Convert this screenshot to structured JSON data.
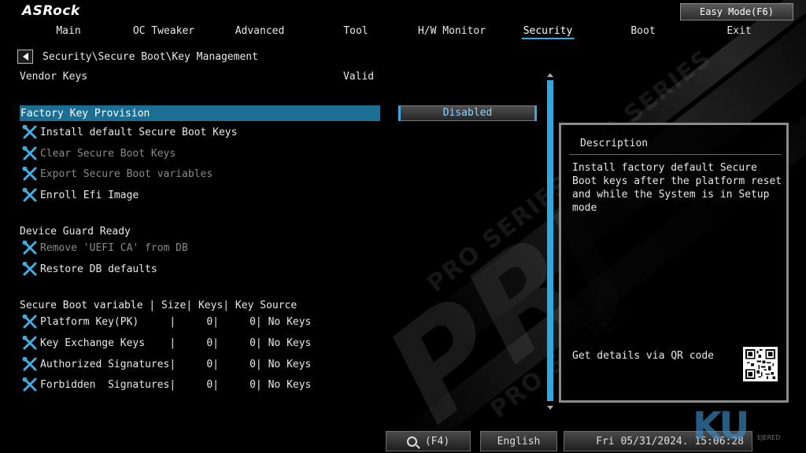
{
  "brand": {
    "logo": "ASRock"
  },
  "header": {
    "easy_mode_label": "Easy Mode(F6)"
  },
  "nav": {
    "tabs": [
      {
        "label": "Main"
      },
      {
        "label": "OC Tweaker"
      },
      {
        "label": "Advanced"
      },
      {
        "label": "Tool"
      },
      {
        "label": "H/W Monitor"
      },
      {
        "label": "Security",
        "active": true
      },
      {
        "label": "Boot"
      },
      {
        "label": "Exit"
      }
    ]
  },
  "breadcrumb": "Security\\Secure Boot\\Key Management",
  "settings": {
    "vendor_keys_label": "Vendor Keys",
    "vendor_keys_value": "Valid",
    "factory_key_label": "Factory Key Provision",
    "factory_key_value": "Disabled",
    "actions": [
      {
        "label": "Install default Secure Boot Keys",
        "enabled": true
      },
      {
        "label": "Clear Secure Boot Keys",
        "enabled": false
      },
      {
        "label": "Export Secure Boot variables",
        "enabled": false
      },
      {
        "label": "Enroll Efi Image",
        "enabled": true
      }
    ],
    "device_guard_label": "Device Guard Ready",
    "device_guard_actions": [
      {
        "label": "Remove 'UEFI CA' from DB",
        "enabled": false
      },
      {
        "label": "Restore DB defaults",
        "enabled": true
      }
    ],
    "variables_header": "Secure Boot variable | Size| Keys| Key Source",
    "variables": [
      {
        "label": "Platform Key(PK)     |     0|     0| No Keys"
      },
      {
        "label": "Key Exchange Keys    |     0|     0| No Keys"
      },
      {
        "label": "Authorized Signatures|     0|     0| No Keys"
      },
      {
        "label": "Forbidden  Signatures|     0|     0| No Keys"
      }
    ]
  },
  "description": {
    "title": "Description",
    "text": "Install factory default Secure Boot keys after the platform reset and while the System is in Setup mode",
    "qr_label": "Get details via QR code"
  },
  "footer": {
    "search_label": "(F4)",
    "language": "English",
    "datetime": "Fri 05/31/2024. 15:06:28"
  },
  "watermark": {
    "text": "KU",
    "small": "EJERED"
  },
  "colors": {
    "accent": "#35a9e0",
    "highlight": "#1b6f92",
    "dim_text": "#8a8a8a"
  }
}
